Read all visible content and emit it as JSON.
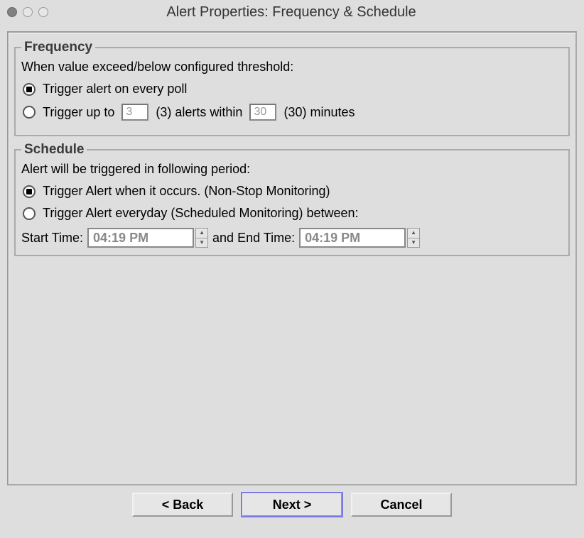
{
  "window": {
    "title": "Alert Properties: Frequency & Schedule"
  },
  "frequency": {
    "legend": "Frequency",
    "description": "When value exceed/below configured threshold:",
    "option_every_poll": "Trigger alert on every poll",
    "option_up_to_prefix": "Trigger up to",
    "alerts_count_value": "3",
    "alerts_count_hint": "(3) alerts within",
    "minutes_value": "30",
    "minutes_hint": "(30) minutes"
  },
  "schedule": {
    "legend": "Schedule",
    "description": "Alert will be triggered in following period:",
    "option_nonstop": "Trigger Alert when it occurs. (Non-Stop Monitoring)",
    "option_scheduled": "Trigger Alert everyday (Scheduled Monitoring) between:",
    "start_label": "Start Time:",
    "start_value": "04:19 PM",
    "mid_label": "and End Time:",
    "end_value": "04:19 PM"
  },
  "buttons": {
    "back": "< Back",
    "next": "Next >",
    "cancel": "Cancel"
  }
}
